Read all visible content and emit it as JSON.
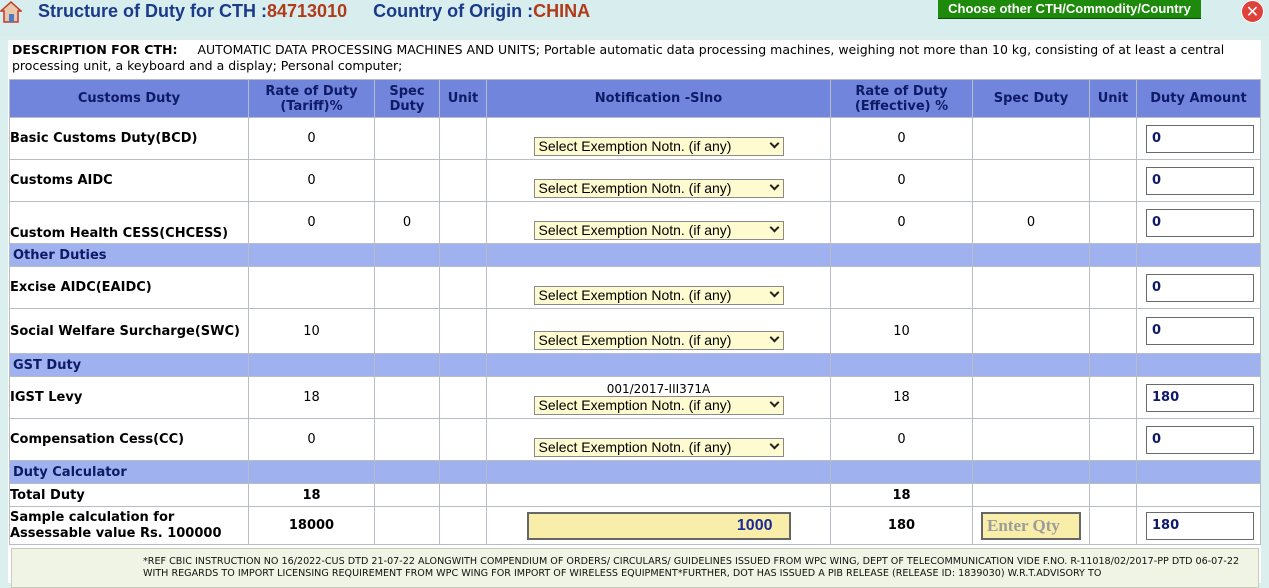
{
  "title": {
    "cth_label": "Structure of Duty for CTH :",
    "cth_value": "84713010",
    "country_label": "Country of Origin :",
    "country_value": "CHINA"
  },
  "buttons": {
    "choose_other": "Choose other CTH/Commodity/Country",
    "close": "✕"
  },
  "description": {
    "label": "DESCRIPTION FOR CTH:",
    "text": "AUTOMATIC DATA PROCESSING MACHINES AND UNITS;  Portable automatic data processing machines, weighing not more than 10 kg, consisting of at least a central processing unit, a keyboard and a display;  Personal computer;"
  },
  "headers": {
    "customs_duty": "Customs Duty",
    "rate_tariff_l1": "Rate of Duty",
    "rate_tariff_l2": "(Tariff)%",
    "spec_duty_l1": "Spec",
    "spec_duty_l2": "Duty",
    "unit": "Unit",
    "notification": "Notification -Slno",
    "rate_eff_l1": "Rate of Duty",
    "rate_eff_l2": "(Effective) %",
    "spec_duty2": "Spec Duty",
    "unit2": "Unit",
    "duty_amount": "Duty Amount"
  },
  "select_placeholder": "Select Exemption Notn. (if any)",
  "rows": {
    "bcd": {
      "label": "Basic Customs Duty(BCD)",
      "tariff": "0",
      "effective": "0",
      "amount": "0"
    },
    "aidc": {
      "label": "Customs AIDC",
      "tariff": "0",
      "effective": "0",
      "amount": "0"
    },
    "chcess": {
      "label": "Custom Health CESS(CHCESS)",
      "tariff": "0",
      "spec": "0",
      "effective": "0",
      "spec2": "0",
      "amount": "0"
    },
    "other_duties": "Other Duties",
    "eaidc": {
      "label": "Excise AIDC(EAIDC)",
      "amount": "0"
    },
    "swc": {
      "label": "Social Welfare Surcharge(SWC)",
      "tariff": "10",
      "effective": "10",
      "amount": "0"
    },
    "gst_duty": "GST Duty",
    "igst": {
      "label": "IGST Levy",
      "tariff": "18",
      "notification_code": "001/2017-III371A",
      "effective": "18",
      "amount": "180"
    },
    "cc": {
      "label": "Compensation Cess(CC)",
      "tariff": "0",
      "effective": "0",
      "amount": "0"
    },
    "duty_calculator": "Duty Calculator",
    "total": {
      "label": "Total Duty",
      "tariff": "18",
      "effective": "18"
    },
    "sample": {
      "label_l1": "Sample calculation for",
      "label_l2": "Assessable value Rs. 100000",
      "tariff": "18000",
      "value_input": "1000",
      "effective": "180",
      "qty_placeholder": "Enter Qty",
      "amount": "180"
    }
  },
  "footer": {
    "text": "*REF CBIC INSTRUCTION NO 16/2022-CUS DTD 21-07-22 ALONGWITH COMPENDIUM OF ORDERS/ CIRCULARS/ GUIDELINES ISSUED FROM WPC WING, DEPT OF TELECOMMUNICATION VIDE F.NO. R-11018/02/2017-PP DTD 06-07-22 WITH REGARDS TO IMPORT LICENSING REQUIREMENT FROM WPC WING FOR IMPORT OF WIRELESS EQUIPMENT*FURTHER, DOT HAS ISSUED A PIB RELEASE (RELEASE ID: 1839030) W.R.T.ADVISORY TO"
  }
}
